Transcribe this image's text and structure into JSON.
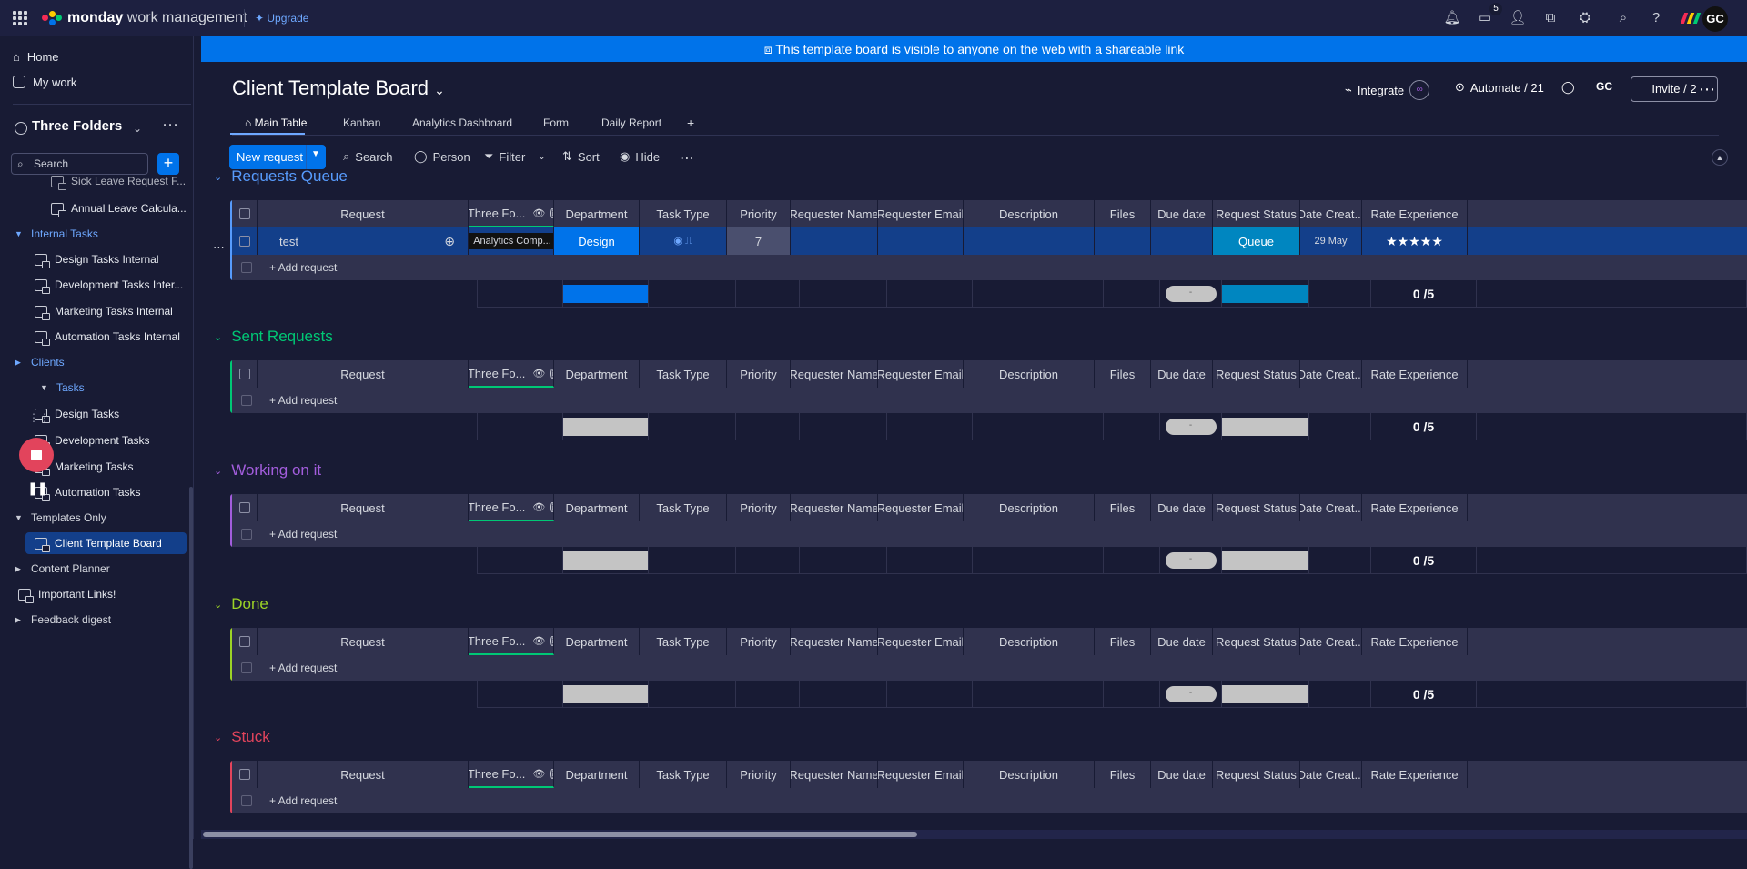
{
  "topbar": {
    "brand_bold": "monday",
    "brand_rest": "work management",
    "upgrade": "Upgrade",
    "inbox_count": "5",
    "avatar": "GC",
    "colors": {
      "logo_red": "#f62b54",
      "logo_yellow": "#ffcc00",
      "logo_green": "#00ca72",
      "logo_blue": "#0073ea"
    }
  },
  "sidebar": {
    "home": "Home",
    "my_work": "My work",
    "workspace": "Three Folders",
    "search_placeholder": "Search",
    "items": {
      "sick_leave": "Sick Leave Request F...",
      "annual_leave": "Annual Leave Calcula...",
      "internal_tasks": "Internal Tasks",
      "design_internal": "Design Tasks Internal",
      "dev_internal": "Development Tasks Inter...",
      "marketing_internal": "Marketing Tasks Internal",
      "automation_internal": "Automation Tasks Internal",
      "clients": "Clients",
      "tasks": "Tasks",
      "design_tasks": "Design Tasks",
      "dev_tasks": "Development Tasks",
      "marketing_tasks": "Marketing Tasks",
      "automation_tasks": "Automation Tasks",
      "templates_only": "Templates Only",
      "client_template_board": "Client Template Board",
      "content_planner": "Content Planner",
      "important_links": "Important Links!",
      "feedback_digest": "Feedback digest"
    }
  },
  "banner": "This template board is visible to anyone on the web with a shareable link",
  "board": {
    "title": "Client Template Board",
    "integrate": "Integrate",
    "automate": "Automate / 21",
    "gc": "GC",
    "invite": "Invite / 2",
    "tabs": [
      "Main Table",
      "Kanban",
      "Analytics Dashboard",
      "Form",
      "Daily Report",
      "+"
    ]
  },
  "toolbar": {
    "new_request": "New request",
    "search": "Search",
    "person": "Person",
    "filter": "Filter",
    "sort": "Sort",
    "hide": "Hide"
  },
  "columns": [
    "Request",
    "Three Fo...",
    "Department",
    "Task Type",
    "Priority",
    "Requester Name",
    "Requester Email",
    "Description",
    "Files",
    "Due date",
    "Request Status",
    "Date Creat...",
    "Rate Experience"
  ],
  "add_row": "+ Add request",
  "groups": [
    {
      "title": "Requests Queue",
      "color": "#579bfc",
      "rating": "0 /5",
      "summary_dept_color": "#0073ea",
      "summary_status_color": "#0086c0"
    },
    {
      "title": "Sent Requests",
      "color": "#00c875",
      "rating": "0 /5",
      "summary_dept_color": "#c4c4c4",
      "summary_status_color": "#c4c4c4"
    },
    {
      "title": "Working on it",
      "color": "#a25ddc",
      "rating": "0 /5",
      "summary_dept_color": "#c4c4c4",
      "summary_status_color": "#c4c4c4"
    },
    {
      "title": "Done",
      "color": "#9cd326",
      "rating": "0 /5",
      "summary_dept_color": "#c4c4c4",
      "summary_status_color": "#c4c4c4"
    },
    {
      "title": "Stuck",
      "color": "#e2445c"
    }
  ],
  "row1": {
    "request": "test",
    "three_folders": "Analytics Comp...",
    "department": "Design",
    "priority": "7",
    "status": "Queue",
    "date_created": "29 May",
    "stars": "★★★★★",
    "colors": {
      "row_bg": "#133f8a",
      "dept": "#0073ea",
      "status": "#0086c0",
      "priority_bg": "#4a4f6e"
    }
  }
}
